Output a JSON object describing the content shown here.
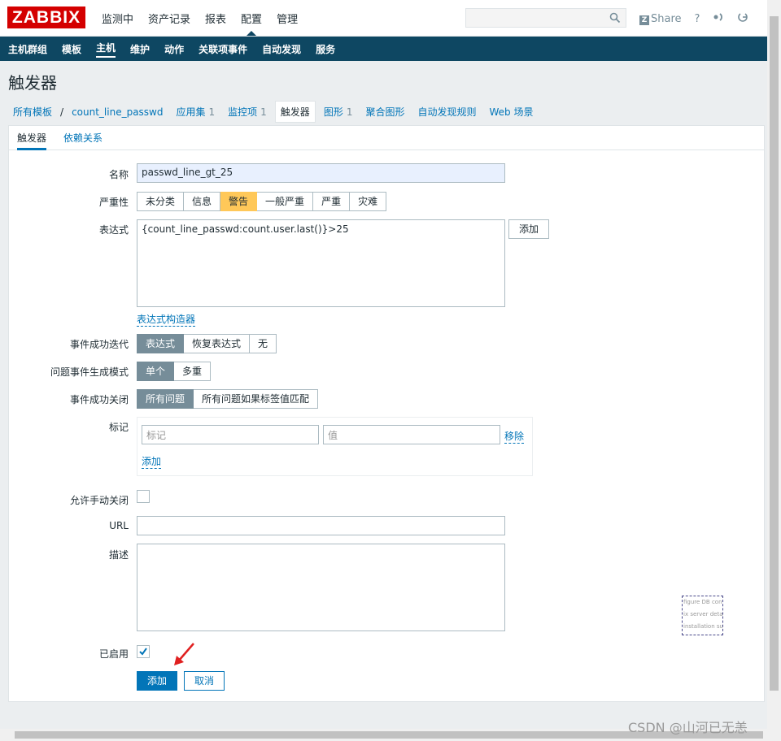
{
  "logo": "ZABBIX",
  "top_nav": [
    "监测中",
    "资产记录",
    "报表",
    "配置",
    "管理"
  ],
  "top_nav_active": "配置",
  "search": {
    "value": "",
    "icon": "search-icon"
  },
  "top_right": {
    "share": "Share",
    "help": "?"
  },
  "sub_nav": [
    "主机群组",
    "模板",
    "主机",
    "维护",
    "动作",
    "关联项事件",
    "自动发现",
    "服务"
  ],
  "sub_nav_active": "主机",
  "page_title": "触发器",
  "breadcrumb": {
    "all_templates": "所有模板",
    "separator": "/",
    "template": "count_line_passwd",
    "items": [
      {
        "label": "应用集",
        "count": "1"
      },
      {
        "label": "监控项",
        "count": "1"
      },
      {
        "label": "触发器",
        "count": ""
      },
      {
        "label": "图形",
        "count": "1"
      },
      {
        "label": "聚合图形",
        "count": ""
      },
      {
        "label": "自动发现规则",
        "count": ""
      },
      {
        "label": "Web 场景",
        "count": ""
      }
    ]
  },
  "tabs": {
    "trigger": "触发器",
    "dependencies": "依赖关系"
  },
  "form": {
    "name_label": "名称",
    "name_value": "passwd_line_gt_25",
    "severity_label": "严重性",
    "severity_options": [
      "未分类",
      "信息",
      "警告",
      "一般严重",
      "严重",
      "灾难"
    ],
    "severity_selected": "警告",
    "expression_label": "表达式",
    "expression_value": "{count_line_passwd:count.user.last()}>25",
    "expression_add": "添加",
    "expression_builder": "表达式构造器",
    "ok_event_gen_label": "事件成功迭代",
    "ok_event_gen_options": [
      "表达式",
      "恢复表达式",
      "无"
    ],
    "ok_event_gen_selected": "表达式",
    "problem_mode_label": "问题事件生成模式",
    "problem_mode_options": [
      "单个",
      "多重"
    ],
    "problem_mode_selected": "单个",
    "ok_close_label": "事件成功关闭",
    "ok_close_options": [
      "所有问题",
      "所有问题如果标签值匹配"
    ],
    "ok_close_selected": "所有问题",
    "tags_label": "标记",
    "tag_placeholder": "标记",
    "value_placeholder": "值",
    "tag_remove": "移除",
    "tag_add": "添加",
    "manual_close_label": "允许手动关闭",
    "url_label": "URL",
    "url_value": "",
    "description_label": "描述",
    "description_value": "",
    "enabled_label": "已启用",
    "enabled": true,
    "submit": "添加",
    "cancel": "取消"
  },
  "side_note_lines": [
    "figure DB conn",
    "ix server detai",
    "installation sun"
  ],
  "watermark": "CSDN @山河已无恙",
  "colors": {
    "brand": "#d40000",
    "nav": "#0e4762",
    "accent": "#0275b8",
    "warning": "#ffc859",
    "selected": "#768d99"
  }
}
